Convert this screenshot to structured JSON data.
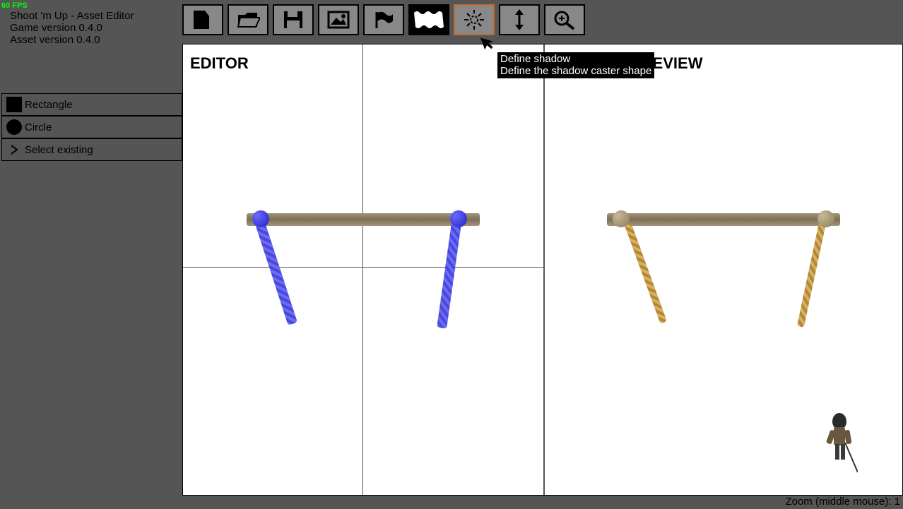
{
  "fps": "60 FPS",
  "app_title": "Shoot 'm Up - Asset Editor",
  "game_version": "Game version 0.4.0",
  "asset_version": "Asset version 0.4.0",
  "toolbar": {
    "items": [
      {
        "name": "new"
      },
      {
        "name": "open"
      },
      {
        "name": "save"
      },
      {
        "name": "image"
      },
      {
        "name": "flag"
      },
      {
        "name": "pattern"
      },
      {
        "name": "shadow"
      },
      {
        "name": "flip-v"
      },
      {
        "name": "zoom"
      }
    ]
  },
  "sidebar": {
    "items": [
      {
        "label": "Rectangle"
      },
      {
        "label": "Circle"
      },
      {
        "label": "Select existing"
      }
    ]
  },
  "panels": {
    "editor_label": "EDITOR",
    "preview_label": "PREVIEW"
  },
  "tooltip": {
    "title": "Define shadow",
    "desc": "Define the shadow caster shape"
  },
  "status": {
    "zoom_label": "Zoom (middle mouse): 1"
  }
}
